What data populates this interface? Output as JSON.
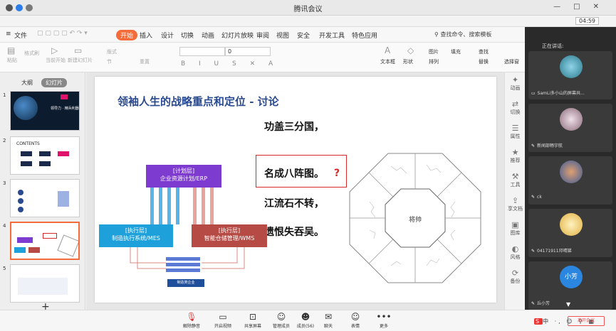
{
  "window": {
    "title": "腾讯会议",
    "time": "04:59"
  },
  "wps": {
    "menus": [
      {
        "label": "文件"
      },
      {
        "label": "开始"
      },
      {
        "label": "插入"
      },
      {
        "label": "设计"
      },
      {
        "label": "切换"
      },
      {
        "label": "动画"
      },
      {
        "label": "幻灯片放映"
      },
      {
        "label": "审阅"
      },
      {
        "label": "视图"
      },
      {
        "label": "安全"
      },
      {
        "label": "开发工具"
      },
      {
        "label": "特色应用"
      }
    ],
    "active_menu": "开始",
    "search_hint": "查找命令、搜索模板",
    "font_size_value": "0",
    "toolbar_labels": {
      "paste": "粘贴",
      "format_painter": "格式刷",
      "from_current": "当前开始",
      "new_slide": "新建幻灯片",
      "layout": "版式",
      "section": "节",
      "reset": "重置",
      "textbox": "文本框",
      "shape": "形状",
      "image": "图片",
      "fill": "填充",
      "arrange": "排列",
      "find": "查找",
      "replace": "替换",
      "select_pane": "选择窗"
    },
    "left_panel": {
      "tabs": [
        "大纲",
        "幻灯片"
      ],
      "selected_tab": "幻灯片",
      "thumb_numbers": [
        "1",
        "2",
        "3",
        "4",
        "5"
      ],
      "thumb1_caption": "领导力 · 精兵利器",
      "thumb2_title": "CONTENTS"
    },
    "right_bar": {
      "items": [
        "动画",
        "切换",
        "属性",
        "推荐",
        "工具",
        "享文档",
        "图库",
        "风格",
        "备份"
      ]
    }
  },
  "slide": {
    "title": "领袖人生的战略重点和定位 - 讨论",
    "poem": [
      "功盖三分国，",
      "名成八阵图。",
      "江流石不转，",
      "遗恨失吞吴。"
    ],
    "question_mark": "?",
    "diagram": {
      "erp_top": "[计划层]",
      "erp_bottom": "企业资源计划/ERP",
      "mes_top": "[执行层]",
      "mes_bottom": "制造执行系统/MES",
      "wms_top": "[执行层]",
      "wms_bottom": "智能仓储管理/WMS",
      "bottom_label": "制造类企业"
    },
    "octagon_center": "将帅"
  },
  "participants": {
    "header": "正在讲话:",
    "list": [
      {
        "name": "SamLi多小山的屏幕共..."
      },
      {
        "name": "新闻部畅宇航"
      },
      {
        "name": "ck"
      },
      {
        "name": "04171911邓晴娣"
      },
      {
        "name": "丘小芳",
        "initials": "小芳"
      }
    ]
  },
  "bottom_bar": {
    "items": [
      {
        "label": "解除静音"
      },
      {
        "label": "开启视频"
      },
      {
        "label": "共享屏幕"
      },
      {
        "label": "管理成员"
      },
      {
        "label": "成员(56)"
      },
      {
        "label": "聊天"
      },
      {
        "label": "表情"
      },
      {
        "label": "更多"
      }
    ],
    "leave": "离开会议"
  },
  "colors": {
    "accent": "#f36c39",
    "erp": "#7d3bcf",
    "mes": "#1ea0db",
    "wms": "#b54b44",
    "title_blue": "#2a4a8f",
    "highlight_red": "#d42a2a"
  }
}
